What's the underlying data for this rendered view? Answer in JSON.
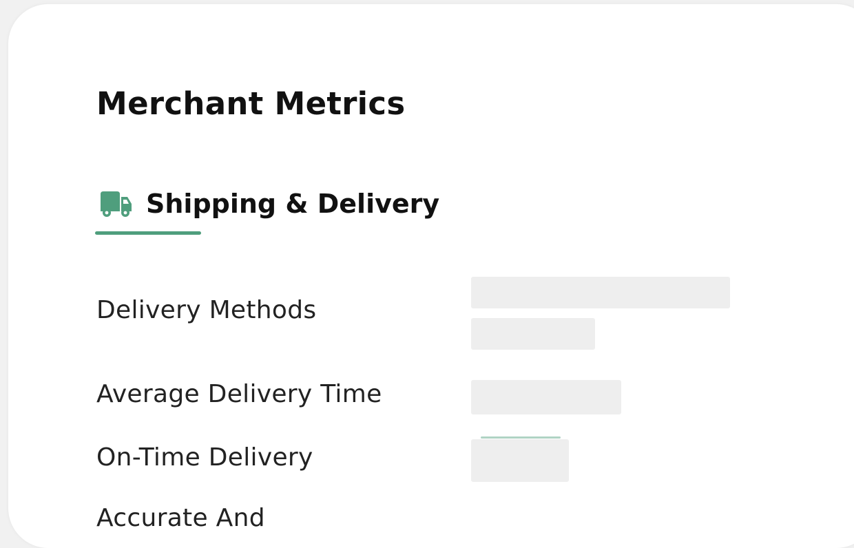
{
  "colors": {
    "accent": "#4f9e7d",
    "skeleton": "#eeeeee"
  },
  "header": {
    "title": "Merchant Metrics"
  },
  "tab": {
    "icon": "truck-icon",
    "label": "Shipping & Delivery"
  },
  "rows": [
    {
      "label": "Delivery Methods"
    },
    {
      "label": "Average Delivery Time"
    },
    {
      "label": "On-Time Delivery"
    },
    {
      "label": "Accurate And"
    }
  ]
}
